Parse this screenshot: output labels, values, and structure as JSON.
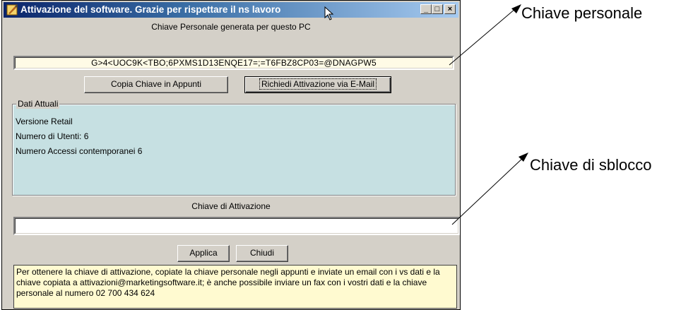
{
  "window": {
    "title": "Attivazione del software. Grazie per rispettare il ns lavoro",
    "controls": {
      "minimize": "_",
      "maximize": "□",
      "close": "×"
    }
  },
  "personal_key": {
    "label": "Chiave Personale generata per questo PC",
    "value": "G>4<UOC9K<TBO;6PXMS1D13ENQE17=;=T6FBZ8CP03=@DNAGPW5"
  },
  "buttons": {
    "copy": "Copia Chiave in Appunti",
    "request_email": "Richiedi Attivazione via E-Mail",
    "apply": "Applica",
    "close": "Chiudi"
  },
  "current_data": {
    "title": "Dati Attuali",
    "lines": [
      "Versione Retail",
      "Numero di Utenti: 6",
      "Numero Accessi contemporanei 6"
    ]
  },
  "activation_key": {
    "label": "Chiave di Attivazione",
    "value": ""
  },
  "info_text": "Per ottenere la chiave di attivazione, copiate la chiave personale negli appunti e inviate un email con i vs dati e la chiave copiata a attivazioni@marketingsoftware.it;  è anche possibile inviare un fax con i vostri dati e la chiave personale al numero 02 700 434 624",
  "annotations": {
    "personal_key": "Chiave personale",
    "unlock_key": "Chiave di sblocco"
  }
}
